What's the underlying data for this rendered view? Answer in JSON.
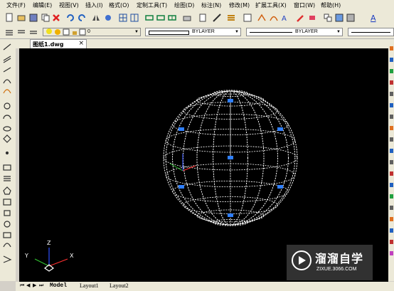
{
  "menu": [
    "文件(F)",
    "编辑(E)",
    "视图(V)",
    "插入(I)",
    "格式(O)",
    "定制工具(T)",
    "绘图(D)",
    "标注(N)",
    "修改(M)",
    "扩展工具(X)",
    "窗口(W)",
    "帮助(H)"
  ],
  "layer": {
    "value": "0"
  },
  "color": {
    "value": "BYLAYER"
  },
  "linetype": {
    "value": "BYLAYER"
  },
  "doc_tab": {
    "label": "图纸1.dwg",
    "close": "×"
  },
  "ucs": {
    "x": "X",
    "y": "Y",
    "z": "Z"
  },
  "layout_tabs": [
    "Model",
    "Layout1",
    "Layout2"
  ],
  "watermark": {
    "brand": "溜溜自学",
    "url": "ZIXUE.3066.COM"
  },
  "colors": {
    "canvas": "#000000",
    "sphere": "#ffffff",
    "grip": "#2f7fff",
    "ui": "#ece9d8",
    "x_axis": "#ff3030",
    "y_axis": "#30c030",
    "z_axis": "#3050ff"
  }
}
